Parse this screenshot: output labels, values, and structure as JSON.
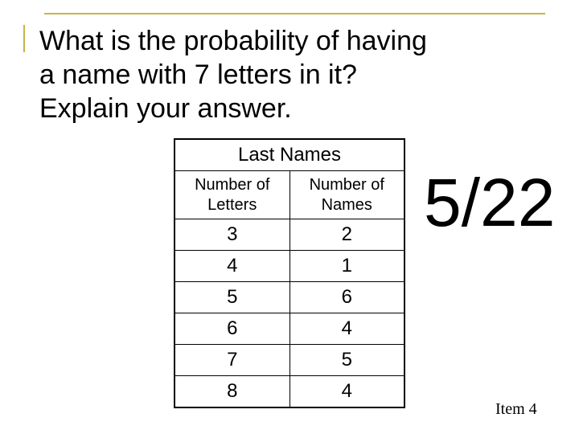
{
  "question": [
    "What is the probability of having",
    "a name with 7 letters in it?",
    "Explain your answer."
  ],
  "table": {
    "title": "Last Names",
    "headers": [
      "Number of Letters",
      "Number of Names"
    ],
    "rows": [
      [
        "3",
        "2"
      ],
      [
        "4",
        "1"
      ],
      [
        "5",
        "6"
      ],
      [
        "6",
        "4"
      ],
      [
        "7",
        "5"
      ],
      [
        "8",
        "4"
      ]
    ]
  },
  "answer": "5/22",
  "footer": "Item 4",
  "colors": {
    "accent": "#c8b44a"
  }
}
